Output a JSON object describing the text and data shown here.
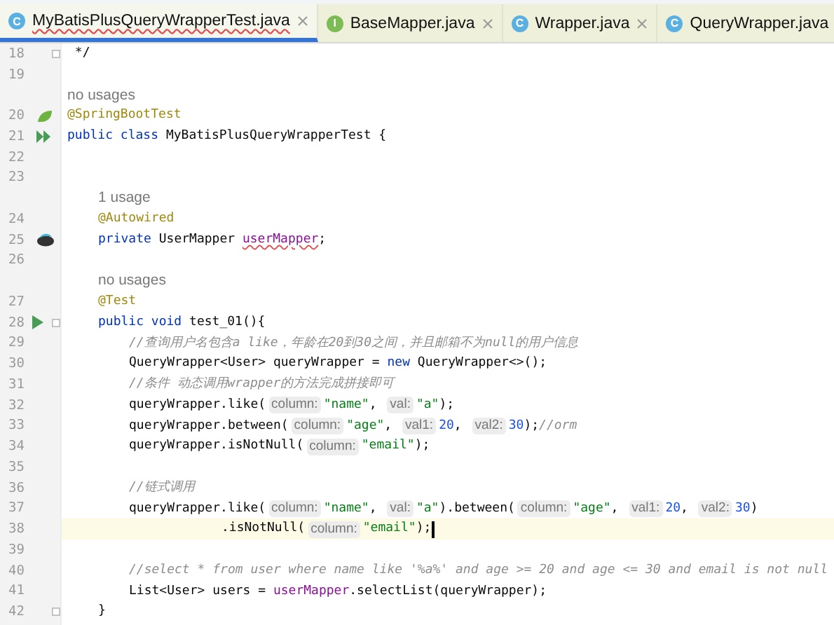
{
  "tabs": [
    {
      "label": "MyBatisPlusQueryWrapperTest.java",
      "kind": "class",
      "icon": "C",
      "selected": true,
      "error": true
    },
    {
      "label": "BaseMapper.java",
      "kind": "interface",
      "icon": "I",
      "selected": false,
      "error": false
    },
    {
      "label": "Wrapper.java",
      "kind": "class",
      "icon": "C",
      "selected": false,
      "error": false
    },
    {
      "label": "QueryWrapper.java",
      "kind": "class",
      "icon": "C",
      "selected": false,
      "error": false
    }
  ],
  "rows": [
    {
      "kind": "code",
      "number": "18",
      "fold": true,
      "tokens": [
        {
          "kind": "comment_plain",
          "text": " */"
        }
      ]
    },
    {
      "kind": "code",
      "number": "19"
    },
    {
      "kind": "usage",
      "text": "no usages"
    },
    {
      "kind": "code",
      "number": "20",
      "gutter_icon": {
        "kind": "spring"
      },
      "tokens": [
        {
          "kind": "annotation",
          "text": "@SpringBootTest"
        }
      ]
    },
    {
      "kind": "code",
      "number": "21",
      "gutter_icon": {
        "kind": "run_class"
      },
      "tokens": [
        {
          "kind": "keyword",
          "text": "public class"
        },
        {
          "kind": "plain",
          "text": " MyBatisPlusQueryWrapperTest {"
        }
      ],
      "children": [
        {
          "kind": "code",
          "number": "22"
        },
        {
          "kind": "code",
          "number": "23"
        },
        {
          "kind": "usage",
          "text": "1 usage"
        },
        {
          "kind": "code",
          "number": "24",
          "tokens": [
            {
              "kind": "annotation",
              "text": "@Autowired"
            }
          ]
        },
        {
          "kind": "code",
          "number": "25",
          "gutter_icon": {
            "kind": "bean"
          },
          "tokens": [
            {
              "kind": "keyword",
              "text": "private"
            },
            {
              "kind": "plain",
              "text": " UserMapper "
            },
            {
              "kind": "field_error",
              "text": "userMapper"
            },
            {
              "kind": "plain",
              "text": ";"
            }
          ]
        },
        {
          "kind": "code",
          "number": "26"
        },
        {
          "kind": "usage",
          "text": "no usages"
        },
        {
          "kind": "code",
          "number": "27",
          "tokens": [
            {
              "kind": "annotation",
              "text": "@Test"
            }
          ]
        },
        {
          "kind": "code",
          "number": "28",
          "gutter_icon": {
            "kind": "run"
          },
          "fold": true,
          "tokens": [
            {
              "kind": "keyword",
              "text": "public void"
            },
            {
              "kind": "plain",
              "text": " test_01(){"
            }
          ],
          "children": [
            {
              "kind": "code",
              "number": "29",
              "tokens": [
                {
                  "kind": "comment",
                  "text": "//查询用户名包含a like，年龄在20到30之间，并且邮箱不为null的用户信息"
                }
              ]
            },
            {
              "kind": "code",
              "number": "30",
              "tokens": [
                {
                  "kind": "plain",
                  "text": "QueryWrapper<User> queryWrapper = "
                },
                {
                  "kind": "keyword",
                  "text": "new"
                },
                {
                  "kind": "plain",
                  "text": " QueryWrapper<>();"
                }
              ]
            },
            {
              "kind": "code",
              "number": "31",
              "tokens": [
                {
                  "kind": "comment",
                  "text": "//条件 动态调用wrapper的方法完成拼接即可"
                }
              ]
            },
            {
              "kind": "code",
              "number": "32",
              "tokens": [
                {
                  "kind": "plain",
                  "text": "queryWrapper.like("
                },
                {
                  "kind": "hint",
                  "text": "column:"
                },
                {
                  "kind": "string",
                  "text": "\"name\""
                },
                {
                  "kind": "plain",
                  "text": ", "
                },
                {
                  "kind": "hint",
                  "text": "val:"
                },
                {
                  "kind": "string",
                  "text": "\"a\""
                },
                {
                  "kind": "plain",
                  "text": ");"
                }
              ]
            },
            {
              "kind": "code",
              "number": "33",
              "tokens": [
                {
                  "kind": "plain",
                  "text": "queryWrapper.between("
                },
                {
                  "kind": "hint",
                  "text": "column:"
                },
                {
                  "kind": "string",
                  "text": "\"age\""
                },
                {
                  "kind": "plain",
                  "text": ", "
                },
                {
                  "kind": "hint",
                  "text": "val1:"
                },
                {
                  "kind": "number",
                  "text": "20"
                },
                {
                  "kind": "plain",
                  "text": ", "
                },
                {
                  "kind": "hint",
                  "text": "val2:"
                },
                {
                  "kind": "number",
                  "text": "30"
                },
                {
                  "kind": "plain",
                  "text": ");"
                },
                {
                  "kind": "comment",
                  "text": "//orm"
                }
              ]
            },
            {
              "kind": "code",
              "number": "34",
              "tokens": [
                {
                  "kind": "plain",
                  "text": "queryWrapper.isNotNull("
                },
                {
                  "kind": "hint",
                  "text": "column:"
                },
                {
                  "kind": "string",
                  "text": "\"email\""
                },
                {
                  "kind": "plain",
                  "text": ");"
                }
              ]
            },
            {
              "kind": "code",
              "number": "35"
            },
            {
              "kind": "code",
              "number": "36",
              "tokens": [
                {
                  "kind": "comment",
                  "text": "//链式调用"
                }
              ]
            },
            {
              "kind": "code",
              "number": "37",
              "tokens": [
                {
                  "kind": "plain",
                  "text": "queryWrapper.like("
                },
                {
                  "kind": "hint",
                  "text": "column:"
                },
                {
                  "kind": "string",
                  "text": "\"name\""
                },
                {
                  "kind": "plain",
                  "text": ", "
                },
                {
                  "kind": "hint",
                  "text": "val:"
                },
                {
                  "kind": "string",
                  "text": "\"a\""
                },
                {
                  "kind": "plain",
                  "text": ").between("
                },
                {
                  "kind": "hint",
                  "text": "column:"
                },
                {
                  "kind": "string",
                  "text": "\"age\""
                },
                {
                  "kind": "plain",
                  "text": ", "
                },
                {
                  "kind": "hint",
                  "text": "val1:"
                },
                {
                  "kind": "number",
                  "text": "20"
                },
                {
                  "kind": "plain",
                  "text": ", "
                },
                {
                  "kind": "hint",
                  "text": "val2:"
                },
                {
                  "kind": "number",
                  "text": "30"
                },
                {
                  "kind": "plain",
                  "text": ")"
                }
              ],
              "children": [
                {
                  "kind": "code",
                  "number": "38",
                  "current": true,
                  "caret": true,
                  "tokens": [
                    {
                      "kind": "plain",
                      "text": ".isNotNull("
                    },
                    {
                      "kind": "hint",
                      "text": "column:"
                    },
                    {
                      "kind": "string",
                      "text": "\"email\""
                    },
                    {
                      "kind": "plain",
                      "text": ");"
                    }
                  ]
                }
              ]
            },
            {
              "kind": "code",
              "number": "39"
            },
            {
              "kind": "code",
              "number": "40",
              "tokens": [
                {
                  "kind": "comment",
                  "text": "//select * from user where name like '%a%' and age >= 20 and age <= 30 and email is not null"
                }
              ]
            },
            {
              "kind": "code",
              "number": "41",
              "tokens": [
                {
                  "kind": "plain",
                  "text": "List<User> users = "
                },
                {
                  "kind": "field",
                  "text": "userMapper"
                },
                {
                  "kind": "plain",
                  "text": ".selectList(queryWrapper);"
                }
              ]
            }
          ]
        },
        {
          "kind": "code",
          "number": "42",
          "fold": true,
          "tokens": [
            {
              "kind": "plain",
              "text": "}"
            }
          ]
        }
      ]
    }
  ]
}
